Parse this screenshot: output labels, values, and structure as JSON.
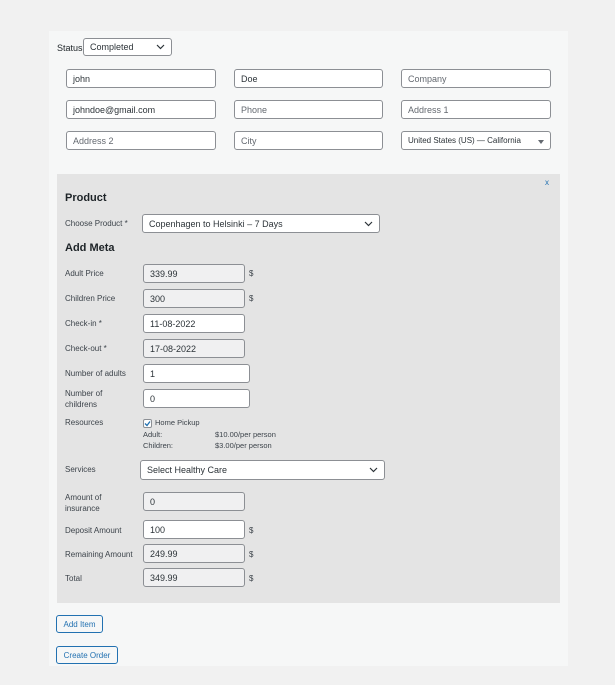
{
  "status": {
    "label": "Status",
    "value": "Completed"
  },
  "customer": {
    "first_name": "john",
    "last_name": "Doe",
    "company_placeholder": "Company",
    "email": "johndoe@gmail.com",
    "phone_placeholder": "Phone",
    "address1_placeholder": "Address 1",
    "address2_placeholder": "Address 2",
    "city_placeholder": "City",
    "country_state": "United States (US) — California"
  },
  "item": {
    "close": "x",
    "product_heading": "Product",
    "choose_product_label": "Choose Product *",
    "choose_product_value": "Copenhagen to Helsinki – 7 Days",
    "meta_heading": "Add Meta",
    "adult_price_label": "Adult Price",
    "adult_price": "339.99",
    "children_price_label": "Children Price",
    "children_price": "300",
    "checkin_label": "Check-in *",
    "checkin": "11-08-2022",
    "checkout_label": "Check-out *",
    "checkout": "17-08-2022",
    "adults_label": "Number of adults",
    "adults": "1",
    "childrens_label_1": "Number of",
    "childrens_label_2": "childrens",
    "childrens": "0",
    "resources_label": "Resources",
    "resource_name": "Home Pickup",
    "resource_checked": true,
    "resource_adult_label": "Adult:",
    "resource_adult_price": "$10.00/per person",
    "resource_children_label": "Children:",
    "resource_children_price": "$3.00/per person",
    "services_label": "Services",
    "services_value": "Select Healthy Care",
    "insurance_label_1": "Amount of",
    "insurance_label_2": "insurance",
    "insurance": "0",
    "deposit_label": "Deposit Amount",
    "deposit": "100",
    "remaining_label": "Remaining Amount",
    "remaining": "249.99",
    "total_label": "Total",
    "total": "349.99",
    "currency": "$"
  },
  "buttons": {
    "add_item": "Add Item",
    "create_order": "Create Order"
  },
  "icons": {
    "dropdown": "chevron-down-icon",
    "small_dropdown": "caret-down-icon",
    "checkbox": "checkmark-icon"
  },
  "colors": {
    "accent": "#2271b1",
    "panel": "#f6f7f7",
    "item_box": "#e4e4e4",
    "readonly_field": "#f0f0f1"
  }
}
